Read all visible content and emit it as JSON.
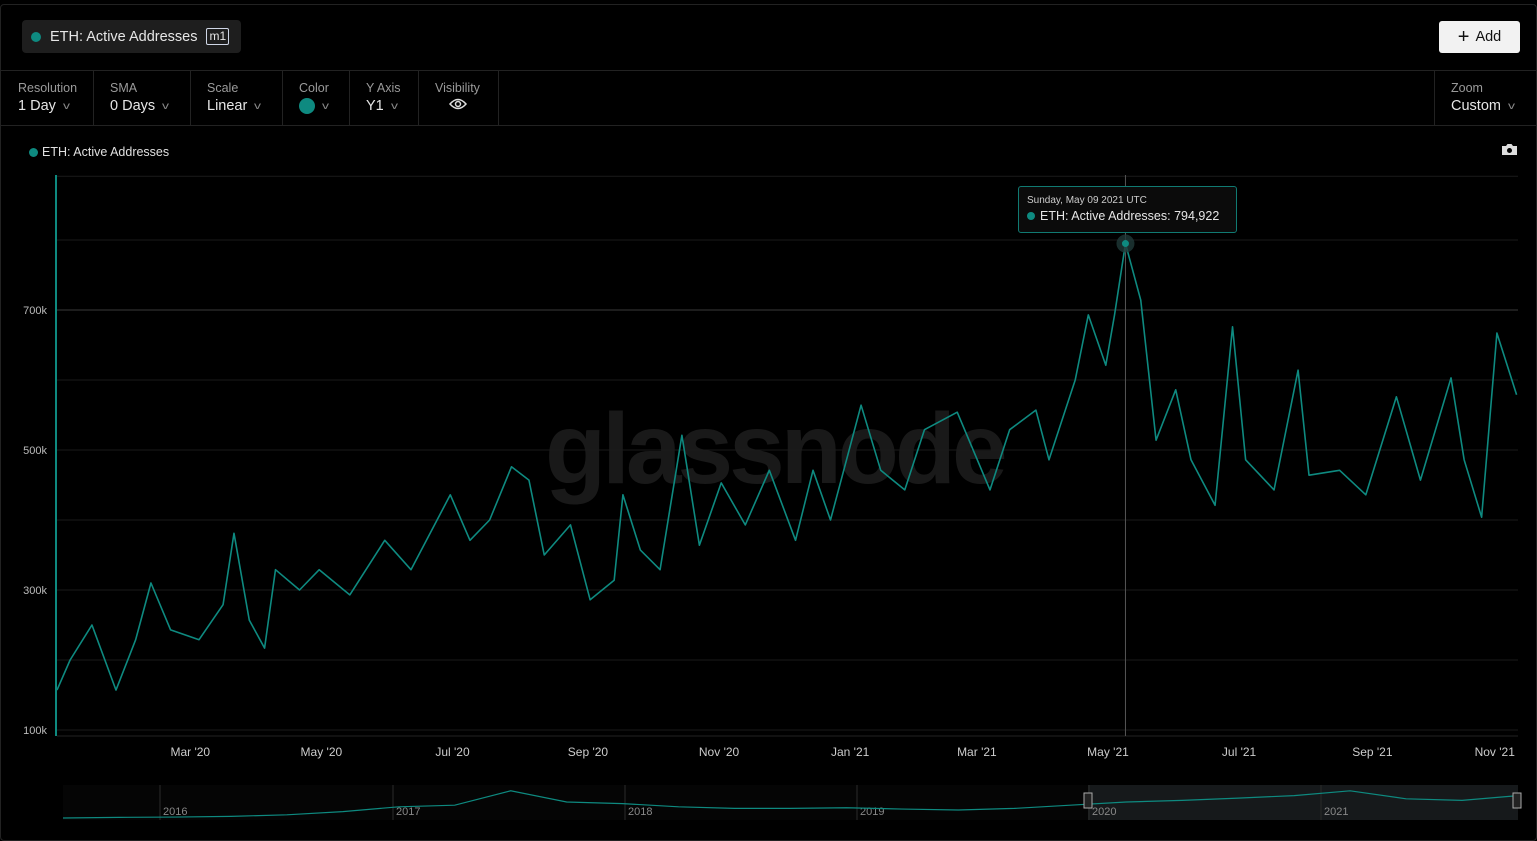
{
  "header": {
    "metric_name": "ETH: Active Addresses",
    "metric_tag": "m1",
    "add_label": "Add"
  },
  "toolbar": {
    "resolution": {
      "label": "Resolution",
      "value": "1 Day"
    },
    "sma": {
      "label": "SMA",
      "value": "0 Days"
    },
    "scale": {
      "label": "Scale",
      "value": "Linear"
    },
    "color": {
      "label": "Color",
      "value": "#0e8a80"
    },
    "yaxis": {
      "label": "Y Axis",
      "value": "Y1"
    },
    "visibility": {
      "label": "Visibility"
    },
    "zoom": {
      "label": "Zoom",
      "value": "Custom"
    }
  },
  "watermark": "glassnode",
  "tooltip": {
    "date": "Sunday, May 09 2021 UTC",
    "label": "ETH: Active Addresses: 794,922",
    "day": 489,
    "value": 794922
  },
  "chart_data": {
    "type": "line",
    "title": "",
    "legend": [
      "ETH: Active Addresses"
    ],
    "legend_position": "top-left",
    "series_color": "#0e8a80",
    "x_unit": "days since 2020-01-01",
    "x_range": [
      0,
      668
    ],
    "ylim": [
      97000,
      891000
    ],
    "y_ticks": [
      {
        "v": 100000,
        "label": "100k"
      },
      {
        "v": 300000,
        "label": "300k"
      },
      {
        "v": 500000,
        "label": "500k"
      },
      {
        "v": 700000,
        "label": "700k"
      }
    ],
    "y_gridlines": [
      100000,
      200000,
      300000,
      400000,
      500000,
      600000,
      700000,
      800000,
      891000
    ],
    "x_ticks": [
      {
        "d": 61,
        "label": "Mar '20"
      },
      {
        "d": 121,
        "label": "May '20"
      },
      {
        "d": 181,
        "label": "Jul '20"
      },
      {
        "d": 243,
        "label": "Sep '20"
      },
      {
        "d": 303,
        "label": "Nov '20"
      },
      {
        "d": 363,
        "label": "Jan '21"
      },
      {
        "d": 421,
        "label": "Mar '21"
      },
      {
        "d": 481,
        "label": "May '21"
      },
      {
        "d": 541,
        "label": "Jul '21"
      },
      {
        "d": 602,
        "label": "Sep '21"
      },
      {
        "d": 658,
        "label": "Nov '21"
      }
    ],
    "series": [
      {
        "name": "ETH: Active Addresses",
        "x": [
          0,
          6,
          16,
          27,
          36,
          43,
          52,
          65,
          76,
          81,
          88,
          95,
          100,
          111,
          120,
          134,
          150,
          162,
          180,
          189,
          198,
          208,
          216,
          223,
          235,
          244,
          255,
          259,
          267,
          276,
          286,
          294,
          304,
          315,
          326,
          338,
          346,
          354,
          368,
          377,
          388,
          397,
          412,
          427,
          436,
          448,
          454,
          466,
          472,
          480,
          484,
          489,
          496,
          503,
          512,
          519,
          530,
          538,
          544,
          557,
          568,
          573,
          587,
          599,
          613,
          624,
          638,
          644,
          652,
          659,
          668
        ],
        "y": [
          157000,
          200000,
          250000,
          157000,
          229000,
          310000,
          243000,
          229000,
          279000,
          381000,
          257000,
          217000,
          329000,
          300000,
          329000,
          293000,
          371000,
          329000,
          436000,
          371000,
          400000,
          476000,
          457000,
          350000,
          393000,
          286000,
          314000,
          436000,
          357000,
          329000,
          521000,
          364000,
          453000,
          393000,
          471000,
          371000,
          471000,
          400000,
          564000,
          471000,
          443000,
          529000,
          554000,
          443000,
          529000,
          557000,
          486000,
          600000,
          693000,
          621000,
          693000,
          794922,
          714000,
          514000,
          586000,
          486000,
          421000,
          676000,
          486000,
          443000,
          614000,
          464000,
          471000,
          436000,
          576000,
          457000,
          603000,
          486000,
          404000,
          667000,
          579000
        ]
      }
    ],
    "navigator": {
      "year_labels": [
        "2016",
        "2017",
        "2018",
        "2019",
        "2020",
        "2021"
      ],
      "selected_range": [
        "2020",
        "2021"
      ],
      "values": [
        0,
        0.02,
        0.03,
        0.05,
        0.1,
        0.2,
        0.35,
        0.4,
        0.85,
        0.5,
        0.45,
        0.35,
        0.3,
        0.3,
        0.32,
        0.28,
        0.25,
        0.3,
        0.4,
        0.5,
        0.55,
        0.62,
        0.7,
        0.85,
        0.6,
        0.55,
        0.7
      ]
    }
  }
}
